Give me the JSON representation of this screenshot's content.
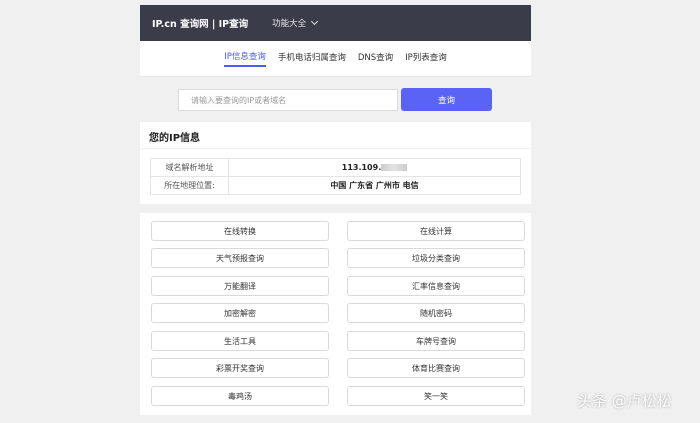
{
  "header": {
    "brand": "IP.cn 查询网 | IP查询",
    "menu_label": "功能大全"
  },
  "tabs": [
    {
      "label": "IP信息查询",
      "active": true
    },
    {
      "label": "手机电话归属查询",
      "active": false
    },
    {
      "label": "DNS查询",
      "active": false
    },
    {
      "label": "IP列表查询",
      "active": false
    }
  ],
  "search": {
    "placeholder": "请输入要查询的IP或者域名",
    "button_label": "查询"
  },
  "ip_info": {
    "title": "您的IP信息",
    "rows": [
      {
        "key": "域名解析地址",
        "value": "113.109."
      },
      {
        "key": "所在地理位置:",
        "value": "中国 广东省 广州市 电信"
      }
    ]
  },
  "tools": [
    "在线转换",
    "在线计算",
    "天气预报查询",
    "垃圾分类查询",
    "万能翻译",
    "汇率信息查询",
    "加密解密",
    "随机密码",
    "生活工具",
    "车牌号查询",
    "彩票开奖查询",
    "体育比赛查询",
    "毒鸡汤",
    "笑一笑"
  ],
  "watermark": "头条 @卢松松",
  "colors": {
    "header_bg": "#3a3c4a",
    "accent": "#5b63f6",
    "tab_active": "#4a5ef0"
  }
}
